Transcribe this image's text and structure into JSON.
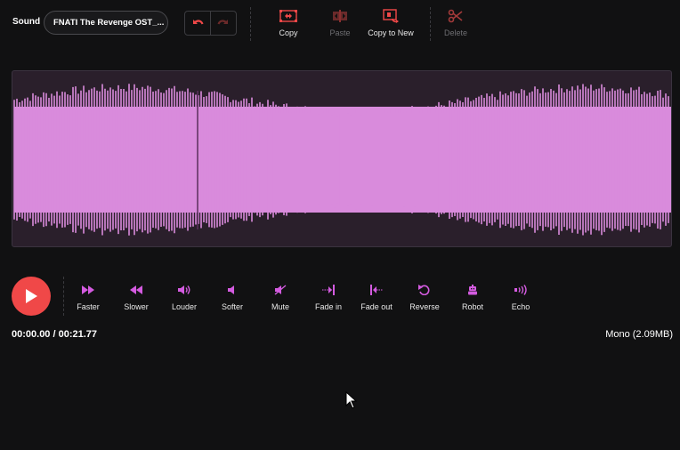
{
  "sound": {
    "label": "Sound",
    "name": "FNATI The Revenge OST_..."
  },
  "history": {
    "undo_icon": "undo-icon",
    "redo_icon": "redo-icon"
  },
  "edit_tools": [
    {
      "label": "Copy",
      "icon": "copy-selection-icon",
      "enabled": true
    },
    {
      "label": "Paste",
      "icon": "paste-icon",
      "enabled": false
    },
    {
      "label": "Copy to New",
      "icon": "copy-to-new-icon",
      "enabled": true
    },
    {
      "label": "Delete",
      "icon": "scissors-icon",
      "enabled": false
    }
  ],
  "effects": [
    {
      "label": "Faster",
      "icon": "fast-forward-icon"
    },
    {
      "label": "Slower",
      "icon": "rewind-icon"
    },
    {
      "label": "Louder",
      "icon": "volume-up-icon"
    },
    {
      "label": "Softer",
      "icon": "volume-down-icon"
    },
    {
      "label": "Mute",
      "icon": "mute-icon"
    },
    {
      "label": "Fade in",
      "icon": "fade-in-icon"
    },
    {
      "label": "Fade out",
      "icon": "fade-out-icon"
    },
    {
      "label": "Reverse",
      "icon": "reverse-icon"
    },
    {
      "label": "Robot",
      "icon": "robot-icon"
    },
    {
      "label": "Echo",
      "icon": "echo-icon"
    }
  ],
  "playback": {
    "current": "00:00.00",
    "separator": " / ",
    "duration": "00:21.77",
    "time_display": "00:00.00 / 00:21.77",
    "channel_info": "Mono (2.09MB)"
  },
  "colors": {
    "accent_red": "#f04848",
    "effect_purple": "#d45be0",
    "waveform_fill": "#d98bdc",
    "waveform_peaks": "#c254c9",
    "waveform_bg": "#2a1f2b",
    "background": "#111112"
  }
}
